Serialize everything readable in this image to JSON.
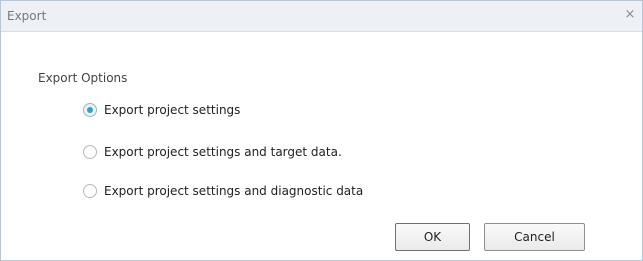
{
  "window": {
    "title": "Export",
    "close_glyph": "×"
  },
  "export_options": {
    "group_label": "Export Options",
    "selected_index": 0,
    "options": [
      {
        "label": "Export project settings",
        "checked": true
      },
      {
        "label": "Export project settings and target data.",
        "checked": false
      },
      {
        "label": "Export project settings and diagnostic data",
        "checked": false
      }
    ]
  },
  "buttons": {
    "ok_label": "OK",
    "cancel_label": "Cancel"
  },
  "colors": {
    "radio_selected": "#35a2c6",
    "titlebar_bg": "#edf1f6"
  }
}
